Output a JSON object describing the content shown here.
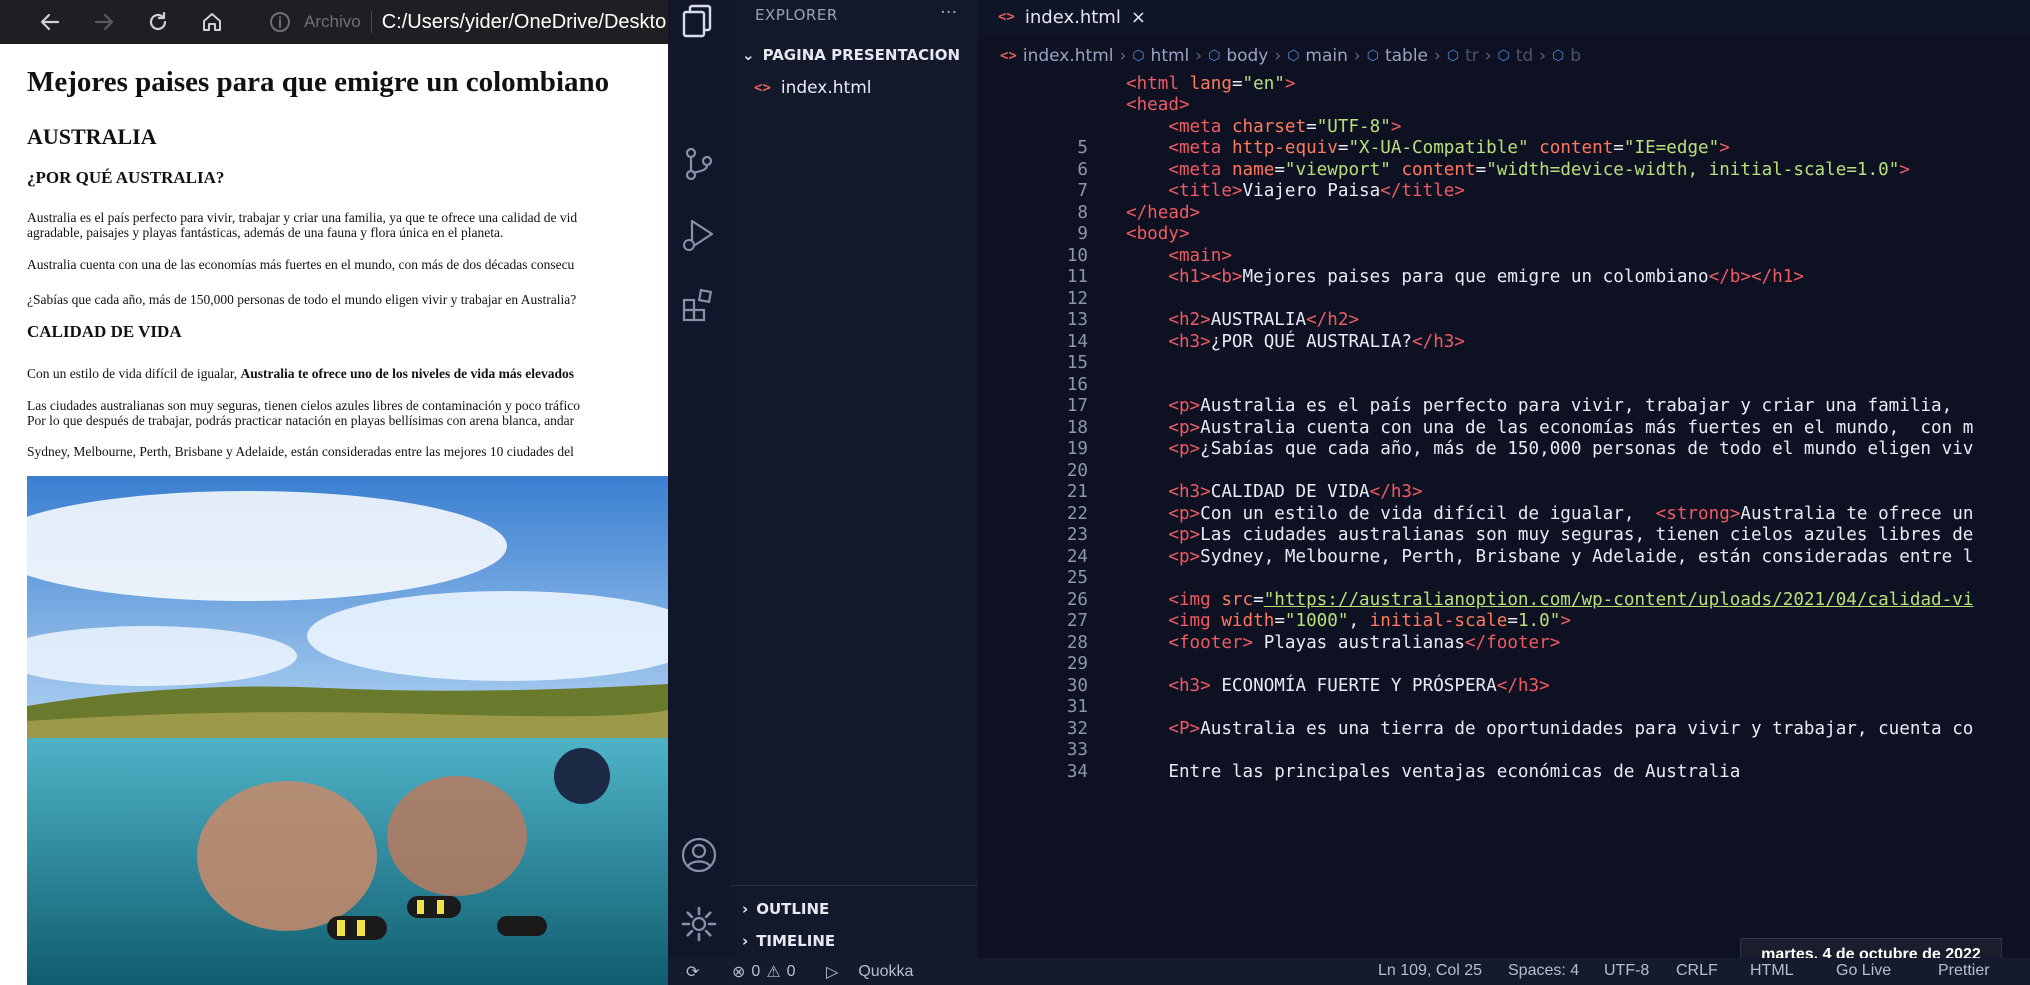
{
  "browser": {
    "secure_label": "Archivo",
    "url": "C:/Users/yider/OneDrive/Deskto",
    "page": {
      "h1": "Mejores paises para que emigre un colombiano",
      "h2": "AUSTRALIA",
      "h3_why": "¿POR QUÉ AUSTRALIA?",
      "p1_line1": "Australia es el país perfecto para vivir, trabajar y criar una familia, ya que te ofrece una calidad de vid",
      "p1_line2": "agradable, paisajes y playas fantásticas, además de una fauna y flora única en el planeta.",
      "p2": "Australia cuenta con una de las economías más fuertes en el mundo, con más de dos décadas consecu",
      "p3": "¿Sabías que cada año, más de 150,000 personas de todo el mundo eligen vivir y trabajar en Australia?",
      "h3_calidad": "CALIDAD DE VIDA",
      "p4_start": "Con un estilo de vida difícil de igualar, ",
      "p4_strong": "Australia te ofrece uno de los niveles de vida más elevados",
      "p5_line1": "Las ciudades australianas son muy seguras, tienen cielos azules libres de contaminación y poco tráfico",
      "p5_line2": "Por lo que después de trabajar, podrás practicar natación en playas bellísimas con arena blanca, andar",
      "p6": "Sydney, Melbourne, Perth, Brisbane y Adelaide, están consideradas entre las mejores 10 ciudades del"
    }
  },
  "vscode": {
    "sidebar": {
      "title": "EXPLORER",
      "more": "···",
      "folder": "PAGINA PRESENTACION",
      "file": "index.html",
      "outline": "OUTLINE",
      "timeline": "TIMELINE"
    },
    "tab": {
      "label": "index.html",
      "close": "×"
    },
    "breadcrumb": [
      "index.html",
      "html",
      "body",
      "main",
      "table",
      "tr",
      "td",
      "b"
    ],
    "code_lines": [
      {
        "n": "",
        "html": "<span class='tag'>&lt;html</span> <span class='attr'>lang</span>=<span class='str'>\"en\"</span><span class='tag'>&gt;</span>"
      },
      {
        "n": "",
        "html": "<span class='tag'>&lt;head&gt;</span>"
      },
      {
        "n": "",
        "html": "    <span class='tag'>&lt;meta</span> <span class='attr'>charset</span>=<span class='str'>\"UTF-8\"</span><span class='tag'>&gt;</span>"
      },
      {
        "n": "5",
        "html": "    <span class='tag'>&lt;meta</span> <span class='attr'>http-equiv</span>=<span class='str'>\"X-UA-Compatible\"</span> <span class='attr'>content</span>=<span class='str'>\"IE=edge\"</span><span class='tag'>&gt;</span>"
      },
      {
        "n": "6",
        "html": "    <span class='tag'>&lt;meta</span> <span class='attr'>name</span>=<span class='str'>\"viewport\"</span> <span class='attr'>content</span>=<span class='str'>\"width=device-width, initial-scale=1.0\"</span><span class='tag'>&gt;</span>"
      },
      {
        "n": "7",
        "html": "    <span class='tag'>&lt;title&gt;</span>Viajero Paisa<span class='tag'>&lt;/title&gt;</span>"
      },
      {
        "n": "8",
        "html": "<span class='tag'>&lt;/head&gt;</span>"
      },
      {
        "n": "9",
        "html": "<span class='tag'>&lt;body&gt;</span>"
      },
      {
        "n": "10",
        "html": "    <span class='tag'>&lt;main&gt;</span>"
      },
      {
        "n": "11",
        "html": "    <span class='tag'>&lt;h1&gt;&lt;b&gt;</span>Mejores paises para que emigre un colombiano<span class='tag'>&lt;/b&gt;&lt;/h1&gt;</span>"
      },
      {
        "n": "12",
        "html": ""
      },
      {
        "n": "13",
        "html": "    <span class='tag'>&lt;h2&gt;</span>AUSTRALIA<span class='tag'>&lt;/h2&gt;</span>"
      },
      {
        "n": "14",
        "html": "    <span class='tag'>&lt;h3&gt;</span>¿POR QUÉ AUSTRALIA?<span class='tag'>&lt;/h3&gt;</span>"
      },
      {
        "n": "15",
        "html": ""
      },
      {
        "n": "16",
        "html": ""
      },
      {
        "n": "17",
        "html": "    <span class='tag'>&lt;p&gt;</span>Australia es el país perfecto para vivir, trabajar y criar una familia,"
      },
      {
        "n": "18",
        "html": "    <span class='tag'>&lt;p&gt;</span>Australia cuenta con una de las economías más fuertes en el mundo,  con m"
      },
      {
        "n": "19",
        "html": "    <span class='tag'>&lt;p&gt;</span>¿Sabías que cada año, más de 150,000 personas de todo el mundo eligen viv"
      },
      {
        "n": "20",
        "html": ""
      },
      {
        "n": "21",
        "html": "    <span class='tag'>&lt;h3&gt;</span>CALIDAD DE VIDA<span class='tag'>&lt;/h3&gt;</span>"
      },
      {
        "n": "22",
        "html": "    <span class='tag'>&lt;p&gt;</span>Con un estilo de vida difícil de igualar,  <span class='tag'>&lt;strong&gt;</span>Australia te ofrece un"
      },
      {
        "n": "23",
        "html": "    <span class='tag'>&lt;p&gt;</span>Las ciudades australianas son muy seguras, tienen cielos azules libres de"
      },
      {
        "n": "24",
        "html": "    <span class='tag'>&lt;p&gt;</span>Sydney, Melbourne, Perth, Brisbane y Adelaide, están consideradas entre l"
      },
      {
        "n": "25",
        "html": ""
      },
      {
        "n": "26",
        "html": "    <span class='tag'>&lt;img</span> <span class='attr'>src</span>=<span class='url'>\"https://australianoption.com/wp-content/uploads/2021/04/calidad-vi</span>"
      },
      {
        "n": "27",
        "html": "    <span class='tag'>&lt;img</span> <span class='attr'>width</span>=<span class='str'>\"1000\"</span>, <span class='attr'>initial-scale</span>=<span class='str'>1.0\"</span><span class='tag'>&gt;</span>"
      },
      {
        "n": "28",
        "html": "    <span class='tag'>&lt;footer&gt;</span> Playas australianas<span class='tag'>&lt;/footer&gt;</span>"
      },
      {
        "n": "29",
        "html": ""
      },
      {
        "n": "30",
        "html": "    <span class='tag'>&lt;h3&gt;</span> ECONOMÍA FUERTE Y PRÓSPERA<span class='tag'>&lt;/h3&gt;</span>"
      },
      {
        "n": "31",
        "html": ""
      },
      {
        "n": "32",
        "html": "    <span class='tag'>&lt;P&gt;</span>Australia es una tierra de oportunidades para vivir y trabajar, cuenta co"
      },
      {
        "n": "33",
        "html": ""
      },
      {
        "n": "34",
        "html": "    Entre las principales ventajas económicas de Australia"
      }
    ],
    "date_popup": "martes, 4 de octubre de 2022",
    "status": {
      "errors": "0",
      "warnings": "0",
      "quokka": "Quokka",
      "position": "Ln 109, Col 25",
      "spaces": "Spaces: 4",
      "encoding": "UTF-8",
      "eol": "CRLF",
      "language": "HTML",
      "golive": "Go Live",
      "prettier": "Prettier"
    },
    "colors": {
      "tag": "#ef5b62",
      "attr": "#ff7a5c",
      "string": "#b7e07a",
      "accent": "#4a8fe0"
    }
  }
}
